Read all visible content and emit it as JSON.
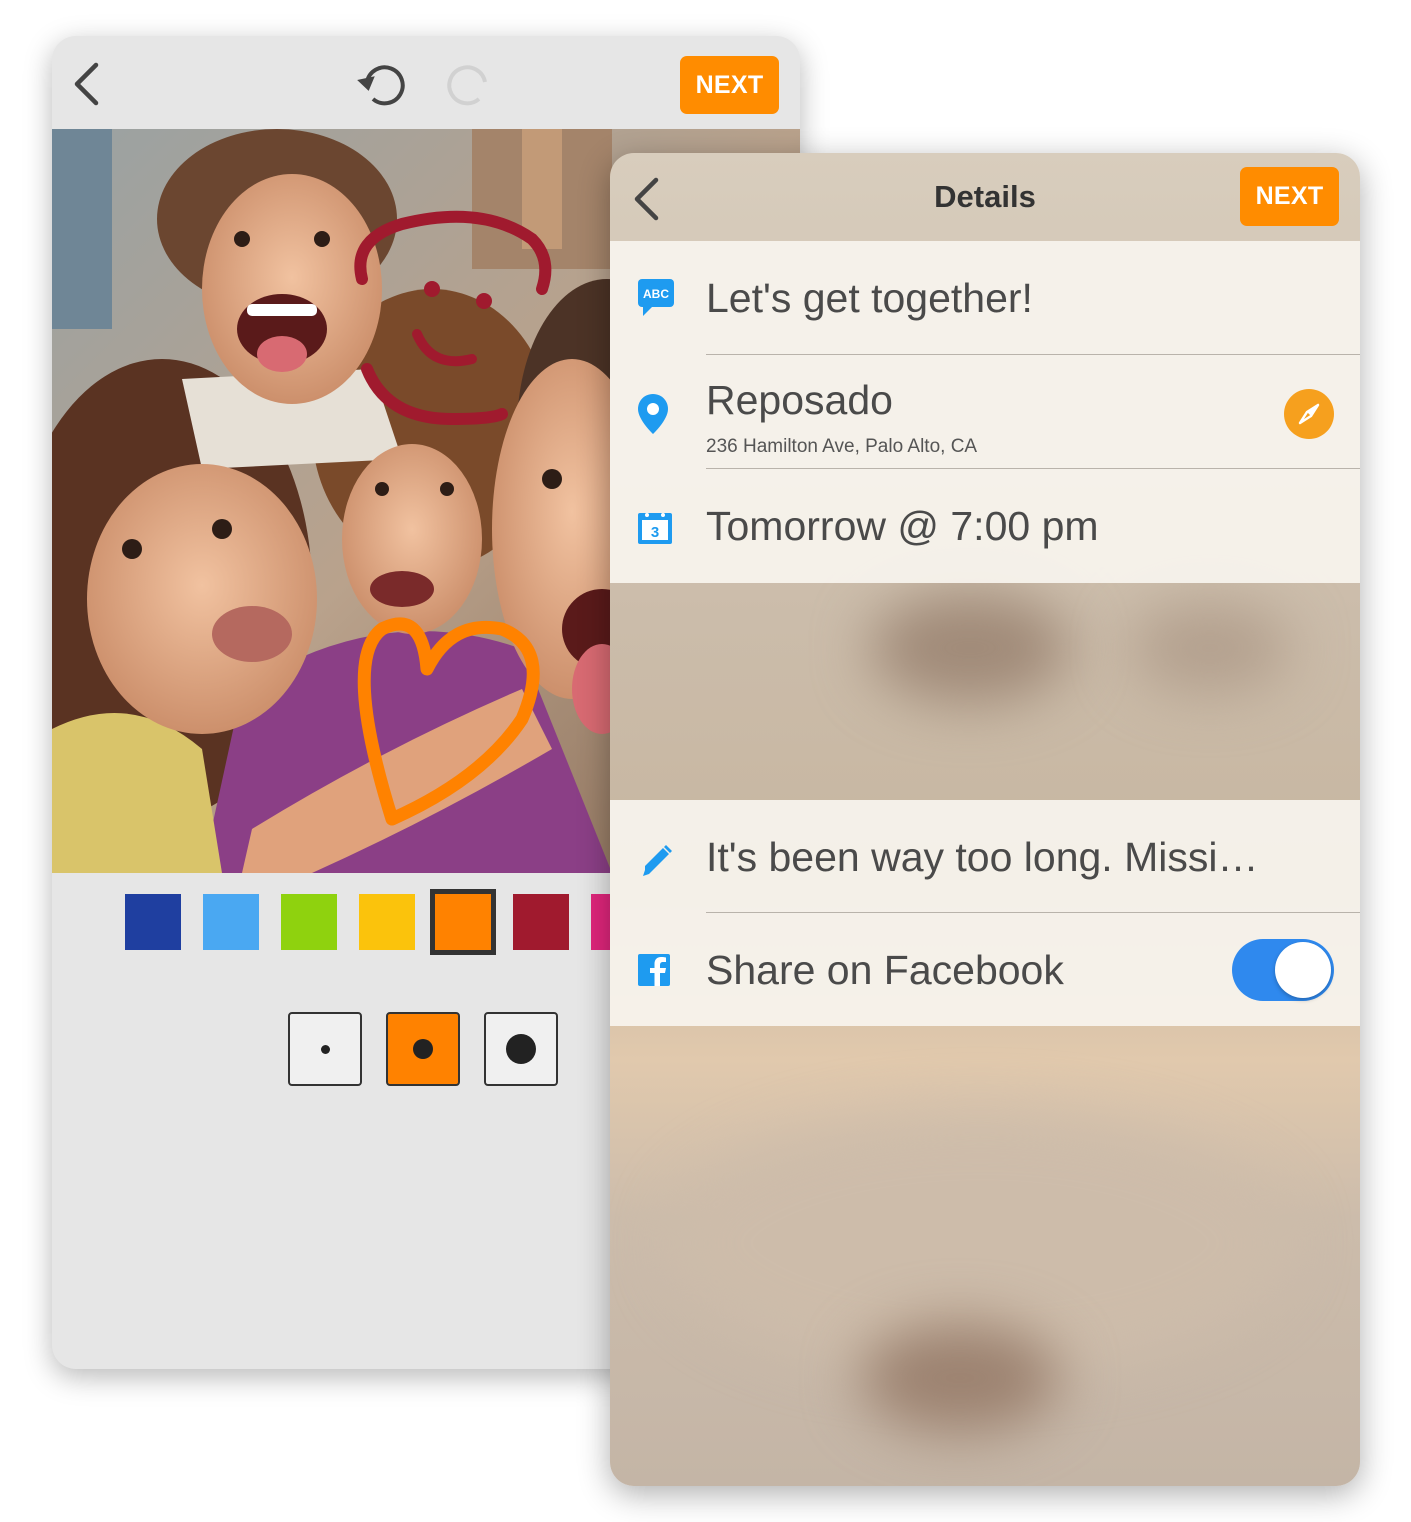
{
  "editor": {
    "next_label": "NEXT",
    "back_icon": "chevron-left-icon",
    "undo_icon": "undo-icon",
    "redo_icon": "redo-icon",
    "palette": [
      {
        "name": "dark-blue",
        "color": "#1f3fa0"
      },
      {
        "name": "light-blue",
        "color": "#4aa8f2"
      },
      {
        "name": "green",
        "color": "#8fd20e"
      },
      {
        "name": "yellow",
        "color": "#fbc30c"
      },
      {
        "name": "orange",
        "color": "#ff8200",
        "selected": true
      },
      {
        "name": "crimson",
        "color": "#a01a2e"
      },
      {
        "name": "pink",
        "color": "#e0267c"
      }
    ],
    "brush_sizes": [
      "small",
      "medium",
      "large"
    ],
    "selected_brush": "medium"
  },
  "details": {
    "title": "Details",
    "next_label": "NEXT",
    "rows": {
      "title": {
        "icon": "abc-message-icon",
        "icon_label": "ABC",
        "text": "Let's get together!"
      },
      "location": {
        "icon": "location-pin-icon",
        "name": "Reposado",
        "address": "236 Hamilton Ave, Palo Alto, CA",
        "action_icon": "compass-icon"
      },
      "time": {
        "icon": "calendar-icon",
        "icon_label": "3",
        "text": "Tomorrow @ 7:00 pm"
      },
      "note": {
        "icon": "pencil-icon",
        "text": "It's been way too long. Missi…"
      },
      "facebook": {
        "icon": "facebook-icon",
        "text": "Share on Facebook",
        "toggle_on": true
      }
    }
  },
  "colors": {
    "accent": "#ff8c00",
    "blue": "#2f89ee",
    "icon_blue": "#1e9bf0"
  }
}
